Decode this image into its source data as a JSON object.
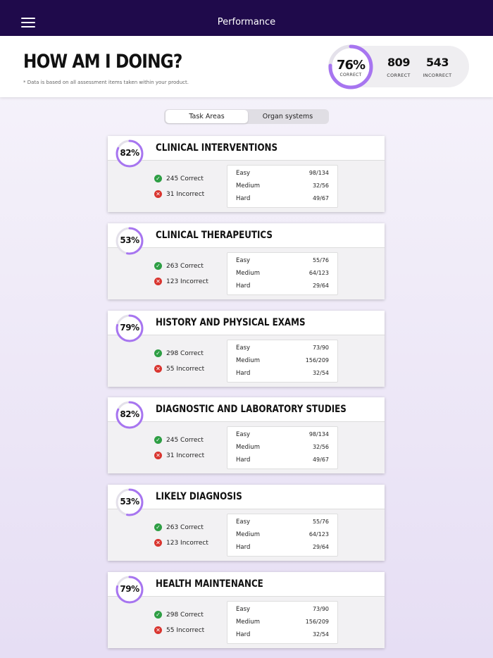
{
  "app": {
    "title": "Performance"
  },
  "header": {
    "title": "HOW AM I DOING?",
    "note": "* Data is based on all assessment items taken within your product.",
    "overall": {
      "percent": "76%",
      "percent_value": 76,
      "percent_label": "CORRECT",
      "correct": "809",
      "correct_label": "CORRECT",
      "incorrect": "543",
      "incorrect_label": "INCORRECT"
    }
  },
  "tabs": [
    {
      "label": "Task Areas",
      "active": true
    },
    {
      "label": "Organ systems",
      "active": false
    }
  ],
  "colors": {
    "nav": "#1f0a4b",
    "accent": "#a775f0",
    "correct": "#2e9e44",
    "incorrect": "#d9352f"
  },
  "cards": [
    {
      "title": "CLINICAL INTERVENTIONS",
      "pct": "82%",
      "pct_value": 82,
      "correct": "245 Correct",
      "incorrect": "31 Incorrect",
      "rows": [
        {
          "label": "Easy",
          "value": "98/134"
        },
        {
          "label": "Medium",
          "value": "32/56"
        },
        {
          "label": "Hard",
          "value": "49/67"
        }
      ]
    },
    {
      "title": "CLINICAL THERAPEUTICS",
      "pct": "53%",
      "pct_value": 53,
      "correct": "263 Correct",
      "incorrect": "123 Incorrect",
      "rows": [
        {
          "label": "Easy",
          "value": "55/76"
        },
        {
          "label": "Medium",
          "value": "64/123"
        },
        {
          "label": "Hard",
          "value": "29/64"
        }
      ]
    },
    {
      "title": "HISTORY AND PHYSICAL EXAMS",
      "pct": "79%",
      "pct_value": 79,
      "correct": "298 Correct",
      "incorrect": "55 Incorrect",
      "rows": [
        {
          "label": "Easy",
          "value": "73/90"
        },
        {
          "label": "Medium",
          "value": "156/209"
        },
        {
          "label": "Hard",
          "value": "32/54"
        }
      ]
    },
    {
      "title": "DIAGNOSTIC AND LABORATORY STUDIES",
      "pct": "82%",
      "pct_value": 82,
      "correct": "245 Correct",
      "incorrect": "31 Incorrect",
      "rows": [
        {
          "label": "Easy",
          "value": "98/134"
        },
        {
          "label": "Medium",
          "value": "32/56"
        },
        {
          "label": "Hard",
          "value": "49/67"
        }
      ]
    },
    {
      "title": "LIKELY DIAGNOSIS",
      "pct": "53%",
      "pct_value": 53,
      "correct": "263 Correct",
      "incorrect": "123 Incorrect",
      "rows": [
        {
          "label": "Easy",
          "value": "55/76"
        },
        {
          "label": "Medium",
          "value": "64/123"
        },
        {
          "label": "Hard",
          "value": "29/64"
        }
      ]
    },
    {
      "title": "HEALTH MAINTENANCE",
      "pct": "79%",
      "pct_value": 79,
      "correct": "298 Correct",
      "incorrect": "55 Incorrect",
      "rows": [
        {
          "label": "Easy",
          "value": "73/90"
        },
        {
          "label": "Medium",
          "value": "156/209"
        },
        {
          "label": "Hard",
          "value": "32/54"
        }
      ]
    }
  ]
}
